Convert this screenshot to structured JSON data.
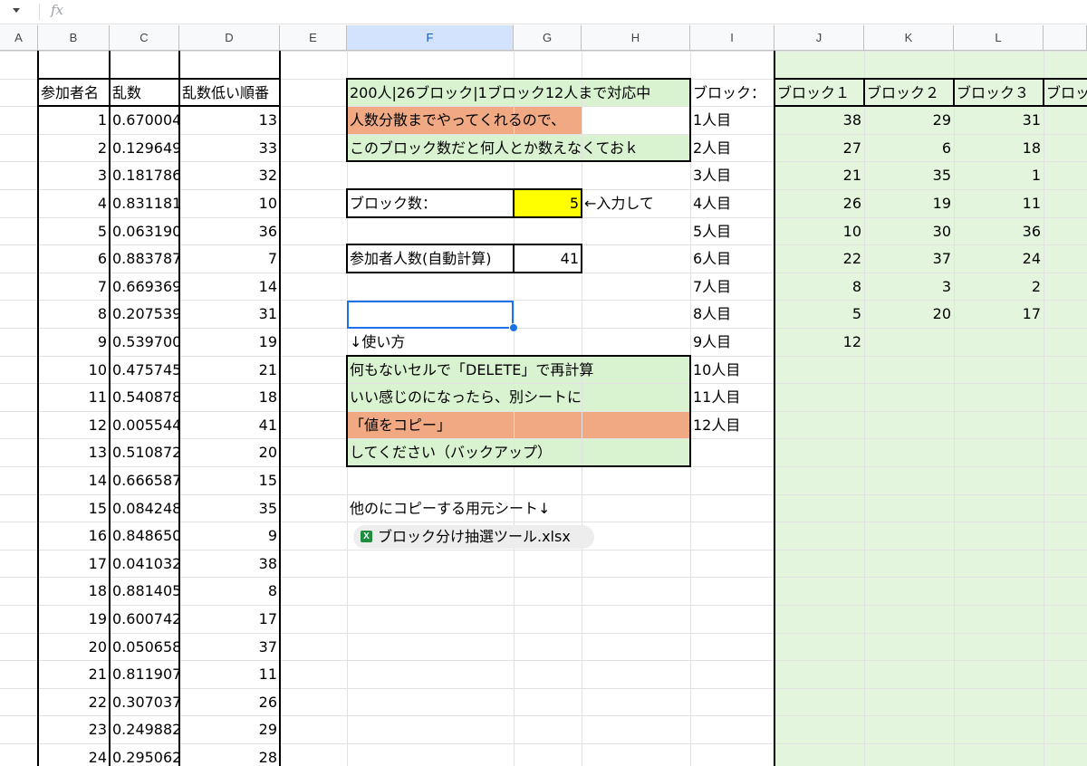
{
  "formula_bar": {
    "fx_label": "fx",
    "value": ""
  },
  "columns": [
    "A",
    "B",
    "C",
    "D",
    "E",
    "F",
    "G",
    "H",
    "I",
    "J",
    "K",
    "L",
    ""
  ],
  "participants": {
    "headers": [
      "参加者名",
      "乱数",
      "乱数低い順番"
    ],
    "rows": [
      [
        "1",
        "0.670004",
        "13"
      ],
      [
        "2",
        "0.129649",
        "33"
      ],
      [
        "3",
        "0.181786",
        "32"
      ],
      [
        "4",
        "0.831181",
        "10"
      ],
      [
        "5",
        "0.063190",
        "36"
      ],
      [
        "6",
        "0.883787",
        "7"
      ],
      [
        "7",
        "0.669369",
        "14"
      ],
      [
        "8",
        "0.207539",
        "31"
      ],
      [
        "9",
        "0.539700",
        "19"
      ],
      [
        "10",
        "0.475745",
        "21"
      ],
      [
        "11",
        "0.540878",
        "18"
      ],
      [
        "12",
        "0.005544",
        "41"
      ],
      [
        "13",
        "0.510872",
        "20"
      ],
      [
        "14",
        "0.666587",
        "15"
      ],
      [
        "15",
        "0.084248",
        "35"
      ],
      [
        "16",
        "0.848650",
        "9"
      ],
      [
        "17",
        "0.041032",
        "38"
      ],
      [
        "18",
        "0.881405",
        "8"
      ],
      [
        "19",
        "0.600742",
        "17"
      ],
      [
        "20",
        "0.050658",
        "37"
      ],
      [
        "21",
        "0.811907",
        "11"
      ],
      [
        "22",
        "0.307037",
        "26"
      ],
      [
        "23",
        "0.249882",
        "29"
      ],
      [
        "24",
        "0.295062",
        "28"
      ]
    ]
  },
  "notice": {
    "line1": "200人|26ブロック|1ブロック12人まで対応中",
    "line2": "人数分散までやってくれるので、",
    "line3": "このブロック数だと何人とか数えなくておｋ"
  },
  "block_count": {
    "label": "ブロック数：",
    "value": "5",
    "hint": "←入力して"
  },
  "participant_count": {
    "label": "参加者人数(自動計算)",
    "value": "41"
  },
  "usage": {
    "heading": "↓使い方",
    "lines": [
      "何もないセルで「DELETE」で再計算",
      "いい感じのになったら、別シートに",
      "「値をコピー」",
      "してください（バックアップ）"
    ]
  },
  "copy_note": "他のにコピーする用元シート↓",
  "file_chip": {
    "label": "ブロック分け抽選ツール.xlsx",
    "icon_glyph": "X"
  },
  "blocks": {
    "row_label_header": "ブロック：",
    "headers": [
      "ブロック１",
      "ブロック２",
      "ブロック３",
      "ブロッ"
    ],
    "row_labels": [
      "1人目",
      "2人目",
      "3人目",
      "4人目",
      "5人目",
      "6人目",
      "7人目",
      "8人目",
      "9人目",
      "10人目",
      "11人目",
      "12人目"
    ],
    "values": [
      [
        "38",
        "29",
        "31"
      ],
      [
        "27",
        "6",
        "18"
      ],
      [
        "21",
        "35",
        "1"
      ],
      [
        "26",
        "19",
        "11"
      ],
      [
        "10",
        "30",
        "36"
      ],
      [
        "22",
        "37",
        "24"
      ],
      [
        "8",
        "3",
        "2"
      ],
      [
        "5",
        "20",
        "17"
      ],
      [
        "12",
        "",
        ""
      ],
      [
        "",
        "",
        ""
      ],
      [
        "",
        "",
        ""
      ],
      [
        "",
        "",
        ""
      ]
    ]
  },
  "colors": {
    "green_fill": "#d9f2d0",
    "light_green": "#e3f5dd",
    "orange_fill": "#f1a983",
    "yellow": "#ffff00",
    "selection": "#1a73e8"
  }
}
